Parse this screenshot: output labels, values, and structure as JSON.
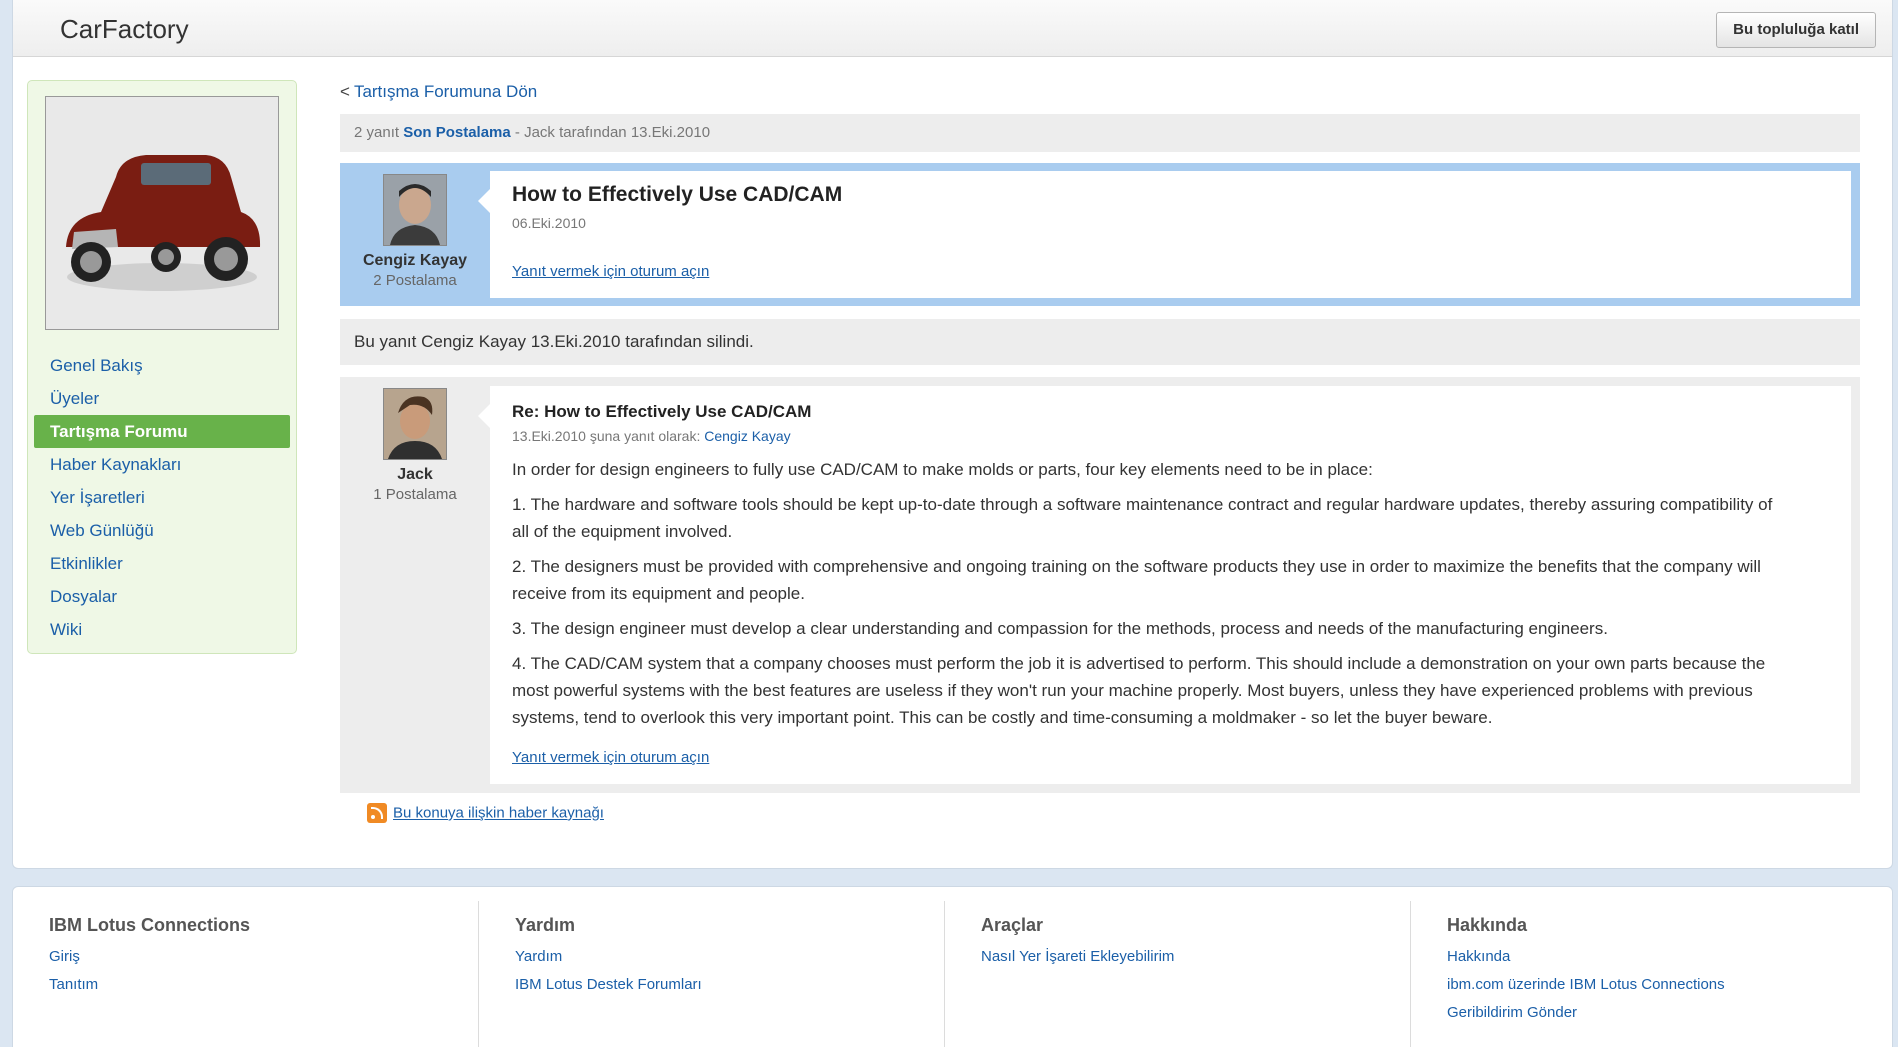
{
  "header": {
    "title": "CarFactory",
    "join_button": "Bu topluluğa katıl"
  },
  "sidebar": {
    "items": [
      {
        "label": "Genel Bakış",
        "active": false
      },
      {
        "label": "Üyeler",
        "active": false
      },
      {
        "label": "Tartışma Forumu",
        "active": true
      },
      {
        "label": "Haber Kaynakları",
        "active": false
      },
      {
        "label": "Yer İşaretleri",
        "active": false
      },
      {
        "label": "Web Günlüğü",
        "active": false
      },
      {
        "label": "Etkinlikler",
        "active": false
      },
      {
        "label": "Dosyalar",
        "active": false
      },
      {
        "label": "Wiki",
        "active": false
      }
    ]
  },
  "content": {
    "back_link": "Tartışma Forumuna Dön",
    "summary": {
      "replies": "2 yanıt",
      "last_post_label": "Son Postalama",
      "last_post_by": "- Jack tarafından 13.Eki.2010"
    },
    "topic": {
      "author": "Cengiz Kayay",
      "author_posts": "2 Postalama",
      "title": "How to Effectively Use CAD/CAM",
      "date": "06.Eki.2010",
      "reply_link": "Yanıt vermek için oturum açın"
    },
    "deleted_notice": "Bu yanıt Cengiz Kayay 13.Eki.2010 tarafından silindi.",
    "reply": {
      "author": "Jack",
      "author_posts": "1 Postalama",
      "title": "Re: How to Effectively Use CAD/CAM",
      "meta_prefix": "13.Eki.2010 şuna yanıt olarak:",
      "meta_author": "Cengiz Kayay",
      "paragraphs": [
        "In order for design engineers to fully use CAD/CAM to make molds or parts, four key elements need to be in place:",
        "1. The hardware and software tools should be kept up-to-date through a software maintenance contract and regular hardware updates, thereby assuring compatibility of all of the equipment involved.",
        "2. The designers must be provided with comprehensive and ongoing training on the software products they use in order to maximize the benefits that the company will receive from its equipment and people.",
        "3. The design engineer must develop a clear understanding and compassion for the methods, process and needs of the manufacturing engineers.",
        "4. The CAD/CAM system that a company chooses must perform the job it is advertised to perform. This should include a demonstration on your own parts because the most powerful systems with the best features are useless if they won't run your machine properly. Most buyers, unless they have experienced problems with previous systems, tend to overlook this very important point. This can be costly and time-consuming a moldmaker - so let the buyer beware."
      ],
      "reply_link": "Yanıt vermek için oturum açın"
    },
    "feed_link": "Bu konuya ilişkin haber kaynağı"
  },
  "footer": {
    "columns": [
      {
        "title": "IBM Lotus Connections",
        "links": [
          "Giriş",
          "Tanıtım"
        ]
      },
      {
        "title": "Yardım",
        "links": [
          "Yardım",
          "IBM Lotus Destek Forumları"
        ]
      },
      {
        "title": "Araçlar",
        "links": [
          "Nasıl Yer İşareti Ekleyebilirim"
        ]
      },
      {
        "title": "Hakkında",
        "links": [
          "Hakkında",
          "ibm.com üzerinde IBM Lotus Connections",
          "Geribildirim Gönder"
        ]
      }
    ]
  },
  "colors": {
    "accent_green": "#68b24a",
    "link_blue": "#1b5fa8",
    "topic_border": "#a9ccef"
  }
}
